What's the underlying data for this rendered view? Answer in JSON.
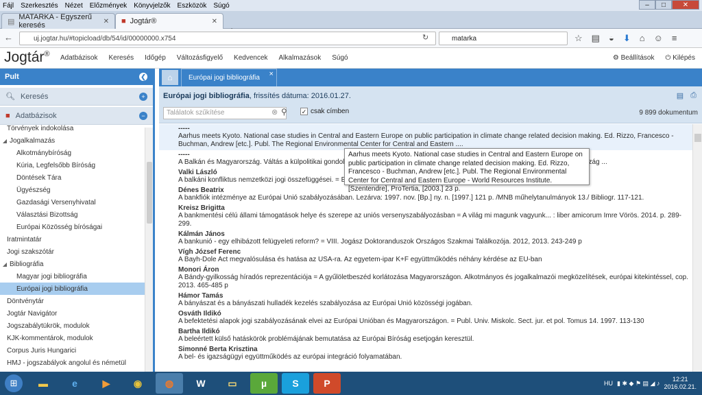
{
  "menu": [
    "Fájl",
    "Szerkesztés",
    "Nézet",
    "Előzmények",
    "Könyvjelzők",
    "Eszközök",
    "Súgó"
  ],
  "browser_tabs": [
    {
      "label": "MATARKA - Egyszerű keresés"
    },
    {
      "label": "Jogtár®"
    }
  ],
  "url": "uj.jogtar.hu/#topicload/db/54/id/00000000.x754",
  "search_value": "matarka",
  "app": {
    "logo": "Jogtár",
    "logo_mark": "®",
    "nav": [
      "Adatbázisok",
      "Keresés",
      "Időgép",
      "Változásfigyelő",
      "Kedvencek",
      "Alkalmazások",
      "Súgó"
    ],
    "settings": "Beállítások",
    "logout": "Kilépés"
  },
  "sidebar": {
    "header": "Pult",
    "search_section": "Keresés",
    "db_section": "Adatbázisok",
    "items": [
      {
        "label": "Törvények indokolása",
        "indent": 1,
        "tri": ""
      },
      {
        "label": "Jogalkalmazás",
        "indent": 0,
        "tri": "◢"
      },
      {
        "label": "Alkotmánybíróság",
        "indent": 2,
        "tri": ""
      },
      {
        "label": "Kúria, Legfelsőbb Bíróság",
        "indent": 2,
        "tri": ""
      },
      {
        "label": "Döntések Tára",
        "indent": 2,
        "tri": ""
      },
      {
        "label": "Ügyészség",
        "indent": 2,
        "tri": ""
      },
      {
        "label": "Gazdasági Versenyhivatal",
        "indent": 2,
        "tri": ""
      },
      {
        "label": "Választási Bizottság",
        "indent": 2,
        "tri": ""
      },
      {
        "label": "Európai Közösség bíróságai",
        "indent": 2,
        "tri": ""
      },
      {
        "label": "Iratmintatár",
        "indent": 1,
        "tri": ""
      },
      {
        "label": "Jogi szakszótár",
        "indent": 1,
        "tri": ""
      },
      {
        "label": "Bibliográfia",
        "indent": 0,
        "tri": "◢"
      },
      {
        "label": "Magyar jogi bibliográfia",
        "indent": 2,
        "tri": ""
      },
      {
        "label": "Európai jogi bibliográfia",
        "indent": 2,
        "tri": "",
        "selected": true
      },
      {
        "label": "Döntvénytár",
        "indent": 1,
        "tri": ""
      },
      {
        "label": "Jogtár Navigátor",
        "indent": 1,
        "tri": ""
      },
      {
        "label": "Jogszabálytükrök, modulok",
        "indent": 1,
        "tri": ""
      },
      {
        "label": "KJK-kommentárok, modulok",
        "indent": 1,
        "tri": ""
      },
      {
        "label": "Corpus Juris Hungarici",
        "indent": 1,
        "tri": ""
      },
      {
        "label": "HMJ - jogszabályok angolul és németül",
        "indent": 1,
        "tri": ""
      }
    ]
  },
  "main": {
    "tab_label": "Európai jogi bibliográfia",
    "info_title": "Európai jogi bibliográfia",
    "info_date": ", frissítés dátuma: 2016.01.27.",
    "filter_placeholder": "Találatok szűkítése",
    "checkbox_label": "csak címben",
    "doc_count": "9 899 dokumentum",
    "entries": [
      {
        "author": "-----",
        "title": "Aarhus meets Kyoto. National case studies in Central and Eastern Europe on public participation in climate change related decision making. Ed. Rizzo, Francesco - Buchman, Andrew [etc.]. Publ. The Regional Environmental Center for Central and Eastern ....",
        "hl": true
      },
      {
        "author": "-----",
        "title": "A Balkán és Magyarország. Váltás a külpolitikai gondolkodásban ... Európa Intézet, Budapest. Bp. Akaprint ny. 2007. 430 p. /Magyarország ..."
      },
      {
        "author": "Valki László",
        "title": "A balkáni konfliktus nemzetközi jogi összefüggései. = Európai biztonság. 2000. 44-51."
      },
      {
        "author": "Dénes Beatrix",
        "title": "A bankfiók intézménye az Európai Unió szabályozásában. Lezárva: 1997. nov. [Bp.] ny. n. [1997.] 121 p. /MNB műhelytanulmányok 13./ Bibliogr. 117-121."
      },
      {
        "author": "Kreisz Brigitta",
        "title": "A bankmentési célú állami támogatások helye és szerepe az uniós versenyszabályozásban = A világ mi magunk vagyunk... : liber amicorum Imre Vörös. 2014. p. 289-299."
      },
      {
        "author": "Kálmán János",
        "title": "A bankunió - egy elhibázott felügyeleti reform? = VIII. Jogász Doktoranduszok Országos Szakmai Találkozója. 2012, 2013. 243-249 p"
      },
      {
        "author": "Vígh József Ferenc",
        "title": "A Bayh-Dole Act megvalósulása és hatása az USA-ra. Az egyetem-ipar K+F együttműködés néhány kérdése az EU-ban"
      },
      {
        "author": "Monori Áron",
        "title": "A Bándy-gyilkosság híradós reprezentációja = A gyűlöletbeszéd korlátozása Magyarországon. Alkotmányos és jogalkalmazói megközelítések, európai kitekintéssel, cop. 2013. 465-485 p"
      },
      {
        "author": "Hámor Tamás",
        "title": "A bányászat és a bányászati hulladék kezelés szabályozása az Európai Unió közösségi jogában."
      },
      {
        "author": "Osváth Ildikó",
        "title": "A befektetési alapok jogi szabályozásának elvei az Európai Unióban és Magyarországon. = Publ. Univ. Miskolc. Sect. jur. et pol. Tomus 14. 1997. 113-130"
      },
      {
        "author": "Bartha Ildikó",
        "title": "A beleértett külső hatáskörök problémájának bemutatása az Európai Bíróság esetjogán keresztül."
      },
      {
        "author": "Simonné Berta Krisztina",
        "title": "A bel- és igazságügyi együttműködés az európai integráció folyamatában."
      }
    ],
    "tooltip": "Aarhus meets Kyoto. National case studies in Central and Eastern Europe on public participation in climate change related decision making. Ed. Rizzo, Francesco - Buchman, Andrew [etc.]. Publ. The Regional Environmental Center for Central and Eastern Europe - World Resources Institute. [Szentendre], ProTertia, [2003.] 23 p."
  },
  "taskbar": {
    "lang": "HU",
    "time": "12:21",
    "date": "2016.02.21."
  },
  "colors": {
    "accent": "#3a82c9",
    "info_bg": "#d5e3f1",
    "selected": "#a8cdef",
    "taskbar": "#1e4f7a"
  }
}
